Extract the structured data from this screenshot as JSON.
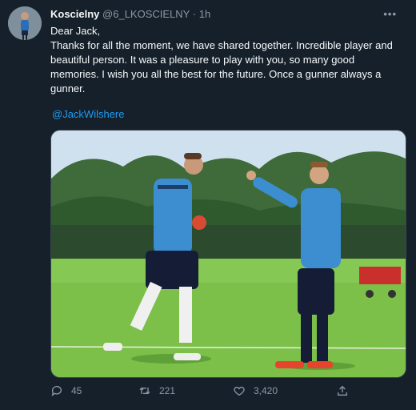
{
  "tweet": {
    "author_name": "Koscielny",
    "author_handle": "@6_LKOSCIELNY",
    "separator": "·",
    "time": "1h",
    "more_label": "•••",
    "text": "Dear Jack,\nThanks for all the moment, we have shared together. Incredible player and\nbeautiful person. It was a pleasure to play with you, so many good\nmemories. I wish you all the best for the future. Once a gunner always a\ngunner.",
    "mention": "@JackWilshere"
  },
  "actions": {
    "replies": "45",
    "retweets": "221",
    "likes": "3,420"
  },
  "icons": {
    "reply": "reply-icon",
    "retweet": "retweet-icon",
    "like": "heart-icon",
    "share": "share-icon"
  },
  "colors": {
    "background": "#15202b",
    "link": "#1d9bf0",
    "muted": "#8b98a5"
  }
}
